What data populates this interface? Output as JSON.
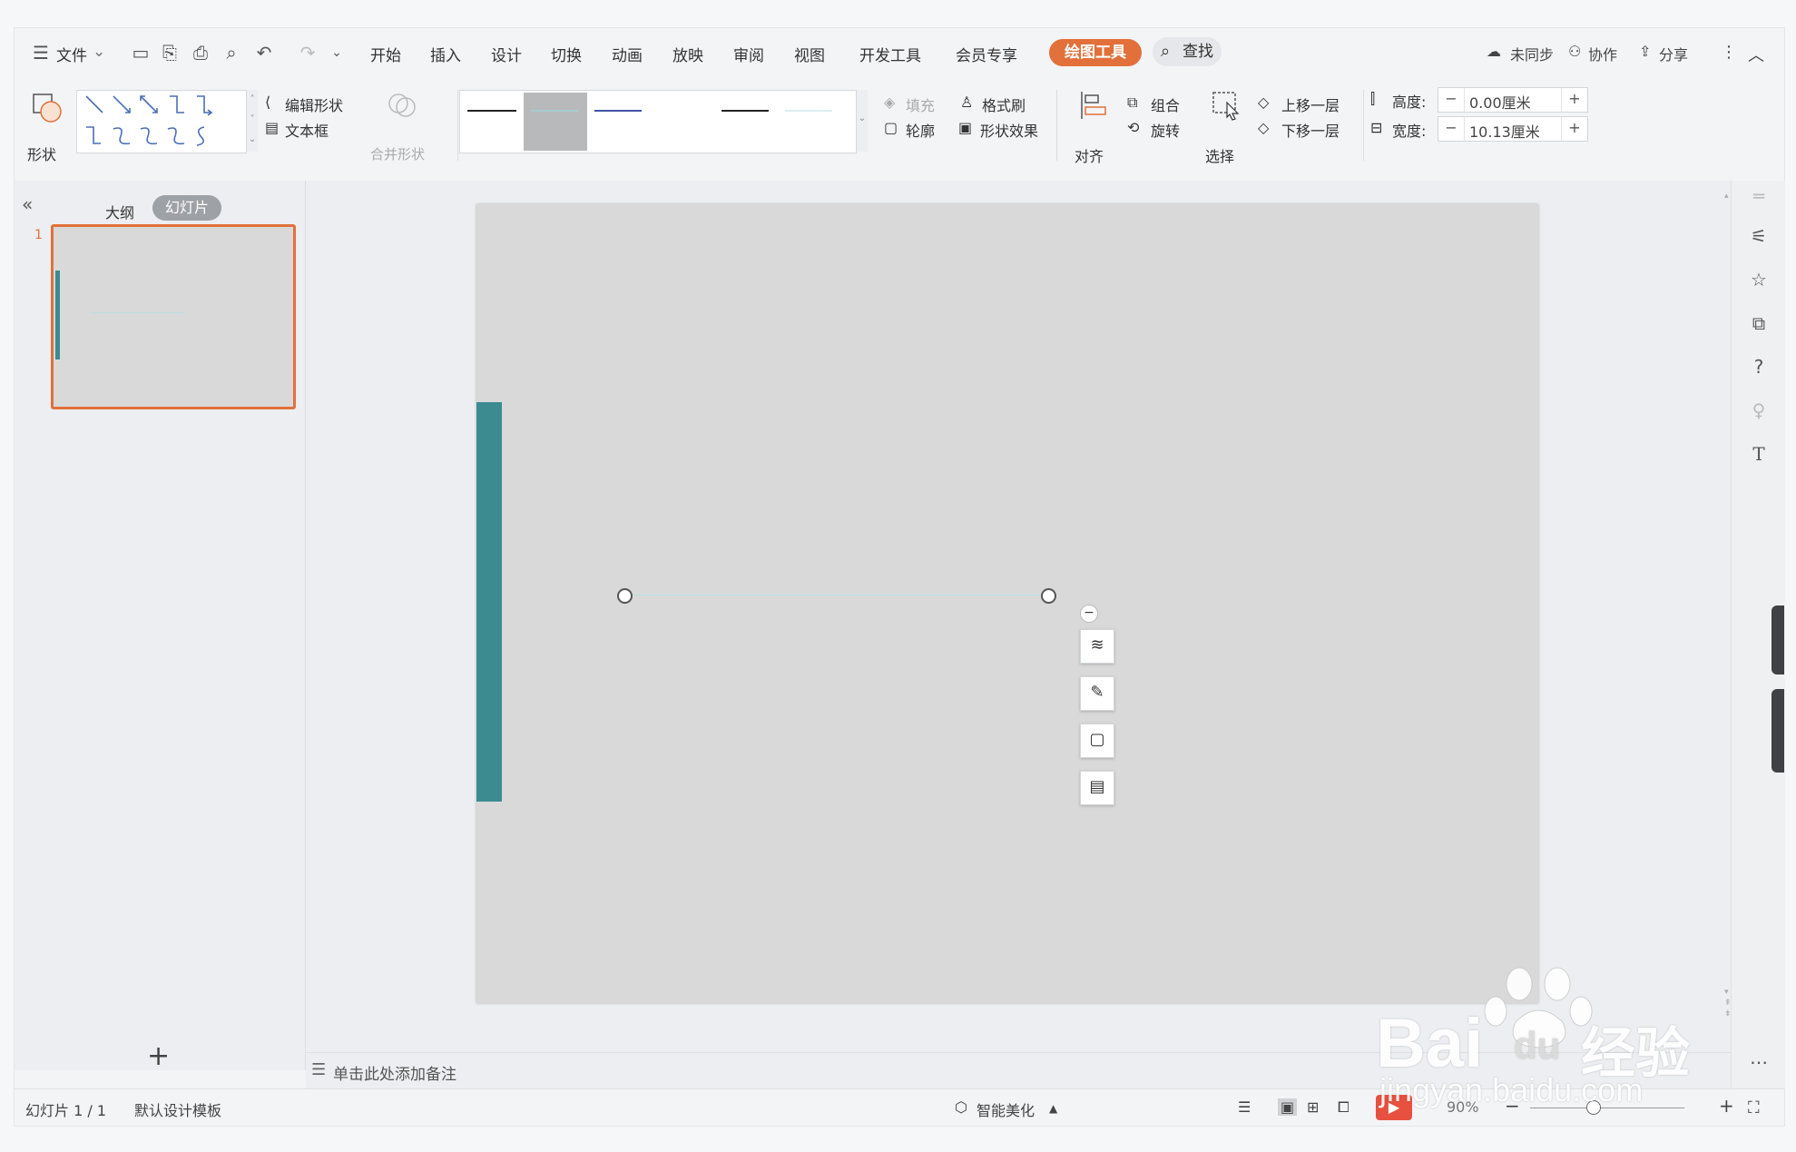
{
  "menu": {
    "file": "文件",
    "tabs": [
      "开始",
      "插入",
      "设计",
      "切换",
      "动画",
      "放映",
      "审阅",
      "视图",
      "开发工具",
      "会员专享"
    ],
    "active_tool_tab": "绘图工具",
    "search": "查找",
    "not_synced": "未同步",
    "collaborate": "协作",
    "share": "分享"
  },
  "ribbon": {
    "shape": "形状",
    "edit_shape": "编辑形状",
    "text_box": "文本框",
    "merge_shape": "合并形状",
    "fill": "填充",
    "format_painter": "格式刷",
    "outline": "轮廓",
    "shape_effect": "形状效果",
    "align": "对齐",
    "group": "组合",
    "rotate": "旋转",
    "select": "选择",
    "bring_forward": "上移一层",
    "send_backward": "下移一层",
    "height_label": "高度:",
    "height_value": "0.00厘米",
    "width_label": "宽度:",
    "width_value": "10.13厘米"
  },
  "left_panel": {
    "tab_outline": "大纲",
    "tab_slides": "幻灯片",
    "slide_number": "1",
    "add": "+"
  },
  "notes_placeholder": "单击此处添加备注",
  "status": {
    "slide_count": "幻灯片 1 / 1",
    "template": "默认设计模板",
    "beautify": "智能美化",
    "zoom": "90%"
  },
  "colors": {
    "accent_bar": "#3b8b91",
    "selected_border": "#e2703a",
    "drawing_tab": "#e2703a"
  },
  "watermark": {
    "brand": "Bai",
    "brand2": "du",
    "brand_cn": "经验",
    "url": "jingyan.baidu.com"
  }
}
